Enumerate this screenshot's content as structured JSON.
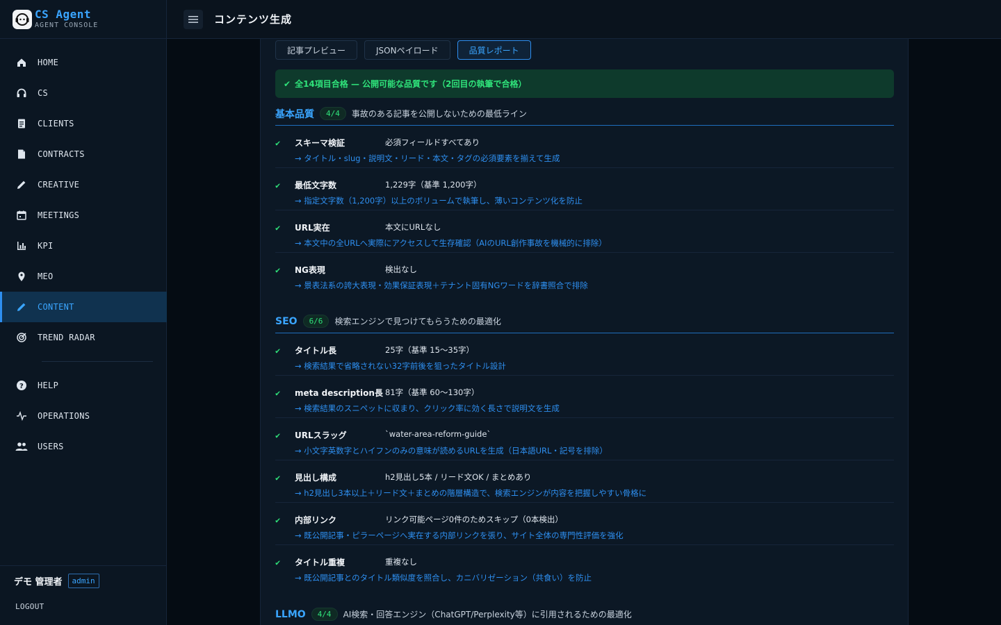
{
  "brand": {
    "title": "CS Agent",
    "subtitle": "AGENT  CONSOLE"
  },
  "nav": {
    "items": [
      {
        "label": "HOME",
        "icon": "home-icon"
      },
      {
        "label": "CS",
        "icon": "headset-icon"
      },
      {
        "label": "CLIENTS",
        "icon": "document-list-icon"
      },
      {
        "label": "CONTRACTS",
        "icon": "file-icon"
      },
      {
        "label": "CREATIVE",
        "icon": "pencil-icon"
      },
      {
        "label": "MEETINGS",
        "icon": "calendar-icon"
      },
      {
        "label": "KPI",
        "icon": "bar-chart-icon"
      },
      {
        "label": "MEO",
        "icon": "map-pin-icon"
      },
      {
        "label": "CONTENT",
        "icon": "pencil-icon",
        "active": true
      },
      {
        "label": "TREND RADAR",
        "icon": "radar-icon"
      }
    ],
    "secondary": [
      {
        "label": "HELP",
        "icon": "help-icon"
      },
      {
        "label": "OPERATIONS",
        "icon": "pulse-icon"
      },
      {
        "label": "USERS",
        "icon": "users-icon"
      }
    ]
  },
  "user": {
    "name": "デモ 管理者",
    "role": "admin",
    "logout": "LOGOUT"
  },
  "header": {
    "title": "コンテンツ生成"
  },
  "tabs": [
    {
      "label": "記事プレビュー"
    },
    {
      "label": "JSONペイロード"
    },
    {
      "label": "品質レポート",
      "active": true
    }
  ],
  "banner": {
    "check": "✔",
    "text": "全14項目合格 — 公開可能な品質です（2回目の執筆で合格）"
  },
  "sections": [
    {
      "title": "基本品質",
      "count": "4/4",
      "desc": "事故のある記事を公開しないための最低ライン",
      "items": [
        {
          "name": "スキーマ検証",
          "result": "必須フィールドすべてあり",
          "note": "→ タイトル・slug・説明文・リード・本文・タグの必須要素を揃えて生成"
        },
        {
          "name": "最低文字数",
          "result": "1,229字（基準 1,200字）",
          "note": "→ 指定文字数（1,200字）以上のボリュームで執筆し、薄いコンテンツ化を防止"
        },
        {
          "name": "URL実在",
          "result": "本文にURLなし",
          "note": "→ 本文中の全URLへ実際にアクセスして生存確認（AIのURL創作事故を機械的に排除）"
        },
        {
          "name": "NG表現",
          "result": "検出なし",
          "note": "→ 景表法系の誇大表現・効果保証表現＋テナント固有NGワードを辞書照合で排除"
        }
      ]
    },
    {
      "title": "SEO",
      "count": "6/6",
      "desc": "検索エンジンで見つけてもらうための最適化",
      "items": [
        {
          "name": "タイトル長",
          "result": "25字（基準 15〜35字）",
          "note": "→ 検索結果で省略されない32字前後を狙ったタイトル設計"
        },
        {
          "name": "meta description長",
          "result": "81字（基準 60〜130字）",
          "note": "→ 検索結果のスニペットに収まり、クリック率に効く長さで説明文を生成"
        },
        {
          "name": "URLスラッグ",
          "result": "`water-area-reform-guide`",
          "note": "→ 小文字英数字とハイフンのみの意味が読めるURLを生成（日本語URL・記号を排除）"
        },
        {
          "name": "見出し構成",
          "result": "h2見出し5本 / リード文OK / まとめあり",
          "note": "→ h2見出し3本以上＋リード文＋まとめの階層構造で、検索エンジンが内容を把握しやすい骨格に"
        },
        {
          "name": "内部リンク",
          "result": "リンク可能ページ0件のためスキップ（0本検出）",
          "note": "→ 既公開記事・ピラーページへ実在する内部リンクを張り、サイト全体の専門性評価を強化"
        },
        {
          "name": "タイトル重複",
          "result": "重複なし",
          "note": "→ 既公開記事とのタイトル類似度を照合し、カニバリゼーション（共食い）を防止"
        }
      ]
    },
    {
      "title": "LLMO",
      "count": "4/4",
      "desc": "AI検索・回答エンジン（ChatGPT/Perplexity等）に引用されるための最適化",
      "items": []
    }
  ]
}
